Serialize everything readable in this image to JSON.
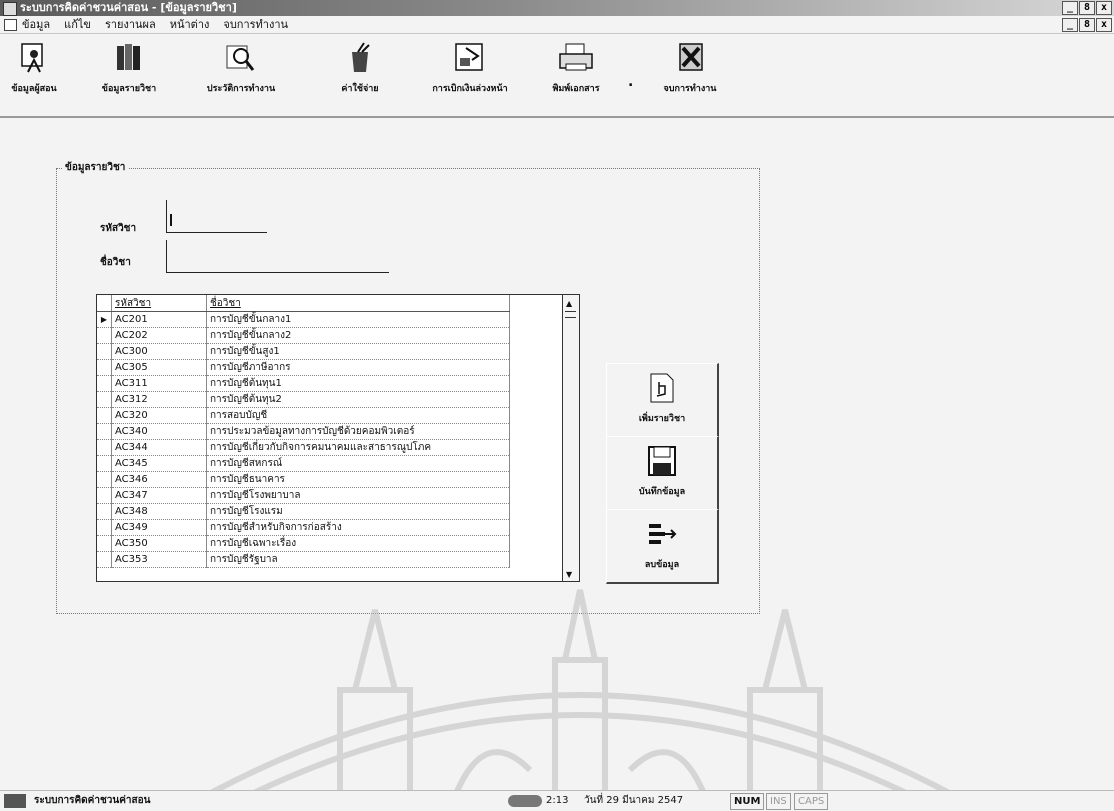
{
  "window": {
    "title": "ระบบการคิดค่าชวนค่าสอน - [ข้อมูลรายวิชา]",
    "controls": [
      "_",
      "8",
      "x"
    ]
  },
  "menu": {
    "items": [
      "ข้อมูล",
      "แก้ไข",
      "รายงานผล",
      "หน้าต่าง",
      "จบการทำงาน"
    ]
  },
  "toolbar": {
    "buttons": [
      {
        "label": "ข้อมูลผู้สอน",
        "icon": "teacher-icon"
      },
      {
        "label": "ข้อมูลรายวิชา",
        "icon": "books-icon"
      },
      {
        "label": "ประวัติการทำงาน",
        "icon": "magnifier-icon"
      },
      {
        "label": "ค่าใช้จ่าย",
        "icon": "paint-cup-icon"
      },
      {
        "label": "การเบิกเงินล่วงหน้า",
        "icon": "money-icon"
      },
      {
        "label": "พิมพ์เอกสาร",
        "icon": "printer-icon"
      },
      {
        "label": "จบการทำงาน",
        "icon": "exit-icon"
      }
    ],
    "separator": "."
  },
  "form": {
    "group_title": "ข้อมูลรายวิชา",
    "code_label": "รหัสวิชา",
    "code_value": "",
    "name_label": "ชื่อวิชา",
    "name_value": ""
  },
  "grid": {
    "columns": [
      "รหัสวิชา",
      "ชื่อวิชา"
    ],
    "rows": [
      {
        "code": "AC201",
        "name": "การบัญชีขั้นกลาง1"
      },
      {
        "code": "AC202",
        "name": "การบัญชีขั้นกลาง2"
      },
      {
        "code": "AC300",
        "name": "การบัญชีขั้นสูง1"
      },
      {
        "code": "AC305",
        "name": "การบัญชีภาษีอากร"
      },
      {
        "code": "AC311",
        "name": "การบัญชีต้นทุน1"
      },
      {
        "code": "AC312",
        "name": "การบัญชีต้นทุน2"
      },
      {
        "code": "AC320",
        "name": "การสอบบัญชี"
      },
      {
        "code": "AC340",
        "name": "การประมวลข้อมูลทางการบัญชีด้วยคอมพิวเตอร์"
      },
      {
        "code": "AC344",
        "name": "การบัญชีเกี่ยวกับกิจการคมนาคมและสาธารณูปโภค"
      },
      {
        "code": "AC345",
        "name": "การบัญชีสหกรณ์"
      },
      {
        "code": "AC346",
        "name": "การบัญชีธนาคาร"
      },
      {
        "code": "AC347",
        "name": "การบัญชีโรงพยาบาล"
      },
      {
        "code": "AC348",
        "name": "การบัญชีโรงแรม"
      },
      {
        "code": "AC349",
        "name": "การบัญชีสำหรับกิจการก่อสร้าง"
      },
      {
        "code": "AC350",
        "name": "การบัญชีเฉพาะเรื่อง"
      },
      {
        "code": "AC353",
        "name": "การบัญชีรัฐบาล"
      }
    ],
    "current_row_marker": "▶"
  },
  "actions": {
    "add_label": "เพิ่มรายวิชา",
    "save_label": "บันทึกข้อมูล",
    "delete_label": "ลบข้อมูล"
  },
  "status": {
    "app_name": "ระบบการคิดค่าชวนค่าสอน",
    "time": "2:13",
    "date": "วันที่ 29 มีนาคม 2547",
    "num": "NUM",
    "ins": "INS",
    "caps": "CAPS"
  }
}
